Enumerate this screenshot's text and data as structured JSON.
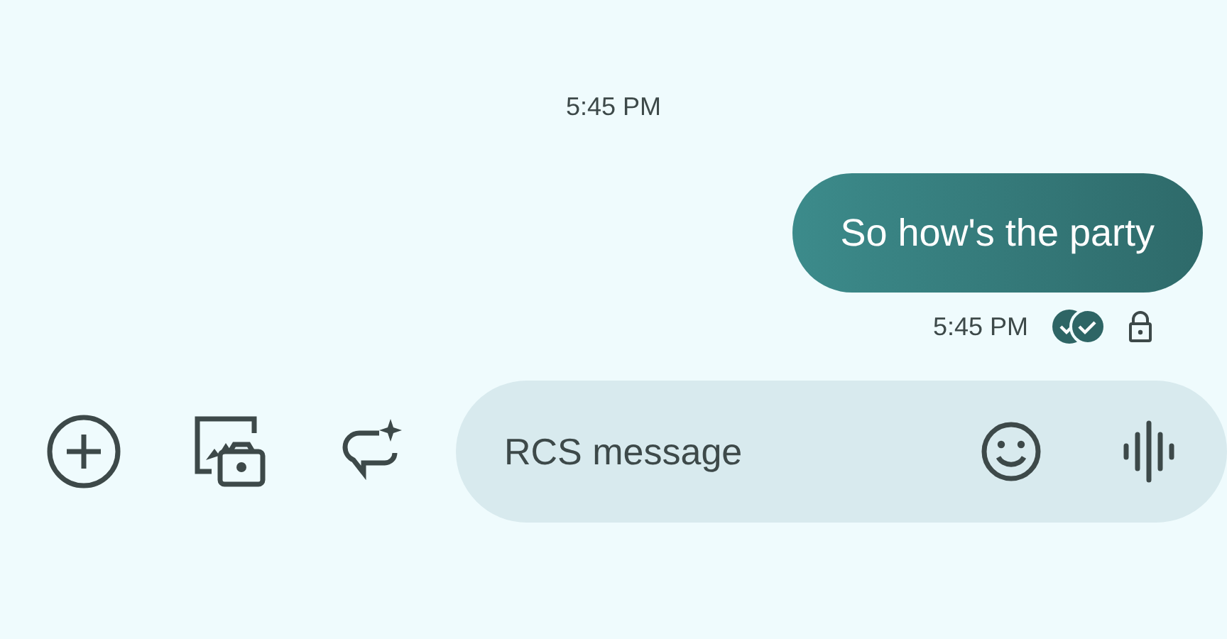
{
  "timestamp": "5:45 PM",
  "messages": [
    {
      "text": "So how's the party",
      "time": "5:45 PM",
      "read": true,
      "encrypted": true
    }
  ],
  "composer": {
    "placeholder": "RCS message"
  }
}
